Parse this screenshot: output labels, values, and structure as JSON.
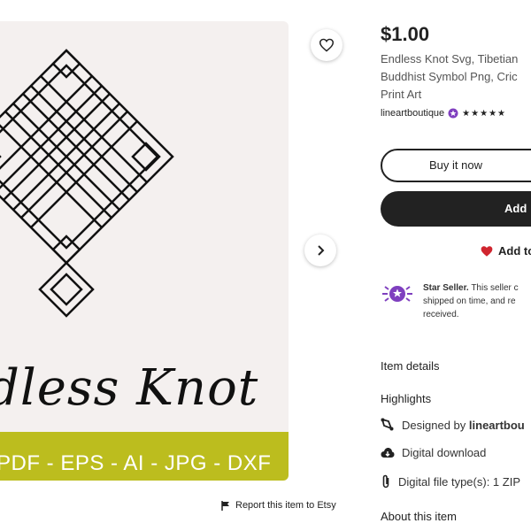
{
  "product_image": {
    "script_title": "dless Knot",
    "formats": "PDF - EPS - AI - JPG - DXF"
  },
  "report_link": "Report this item to Etsy",
  "listing": {
    "price": "$1.00",
    "title_lines": [
      "Endless Knot Svg, Tibetian",
      "Buddhist Symbol Png, Cric",
      "Print Art"
    ],
    "seller": "lineartboutique",
    "rating": "5 stars"
  },
  "buttons": {
    "buy_now": "Buy it now",
    "add_to_cart": "Add",
    "add_to_collection": "Add to"
  },
  "star_seller": {
    "title": "Star Seller.",
    "lines": [
      "This seller c",
      "shipped on time, and re",
      "received."
    ]
  },
  "sections": {
    "item_details": "Item details",
    "highlights": "Highlights",
    "about": "About this item"
  },
  "highlights": {
    "designed_by_prefix": "Designed by",
    "designed_by_name": "lineartbou",
    "digital_download": "Digital download",
    "file_types": "Digital file type(s): 1 ZIP"
  },
  "colors": {
    "accent_band": "#bcbd1e",
    "star_seller_purple": "#7f3fbf",
    "heart_red": "#d0252f"
  }
}
